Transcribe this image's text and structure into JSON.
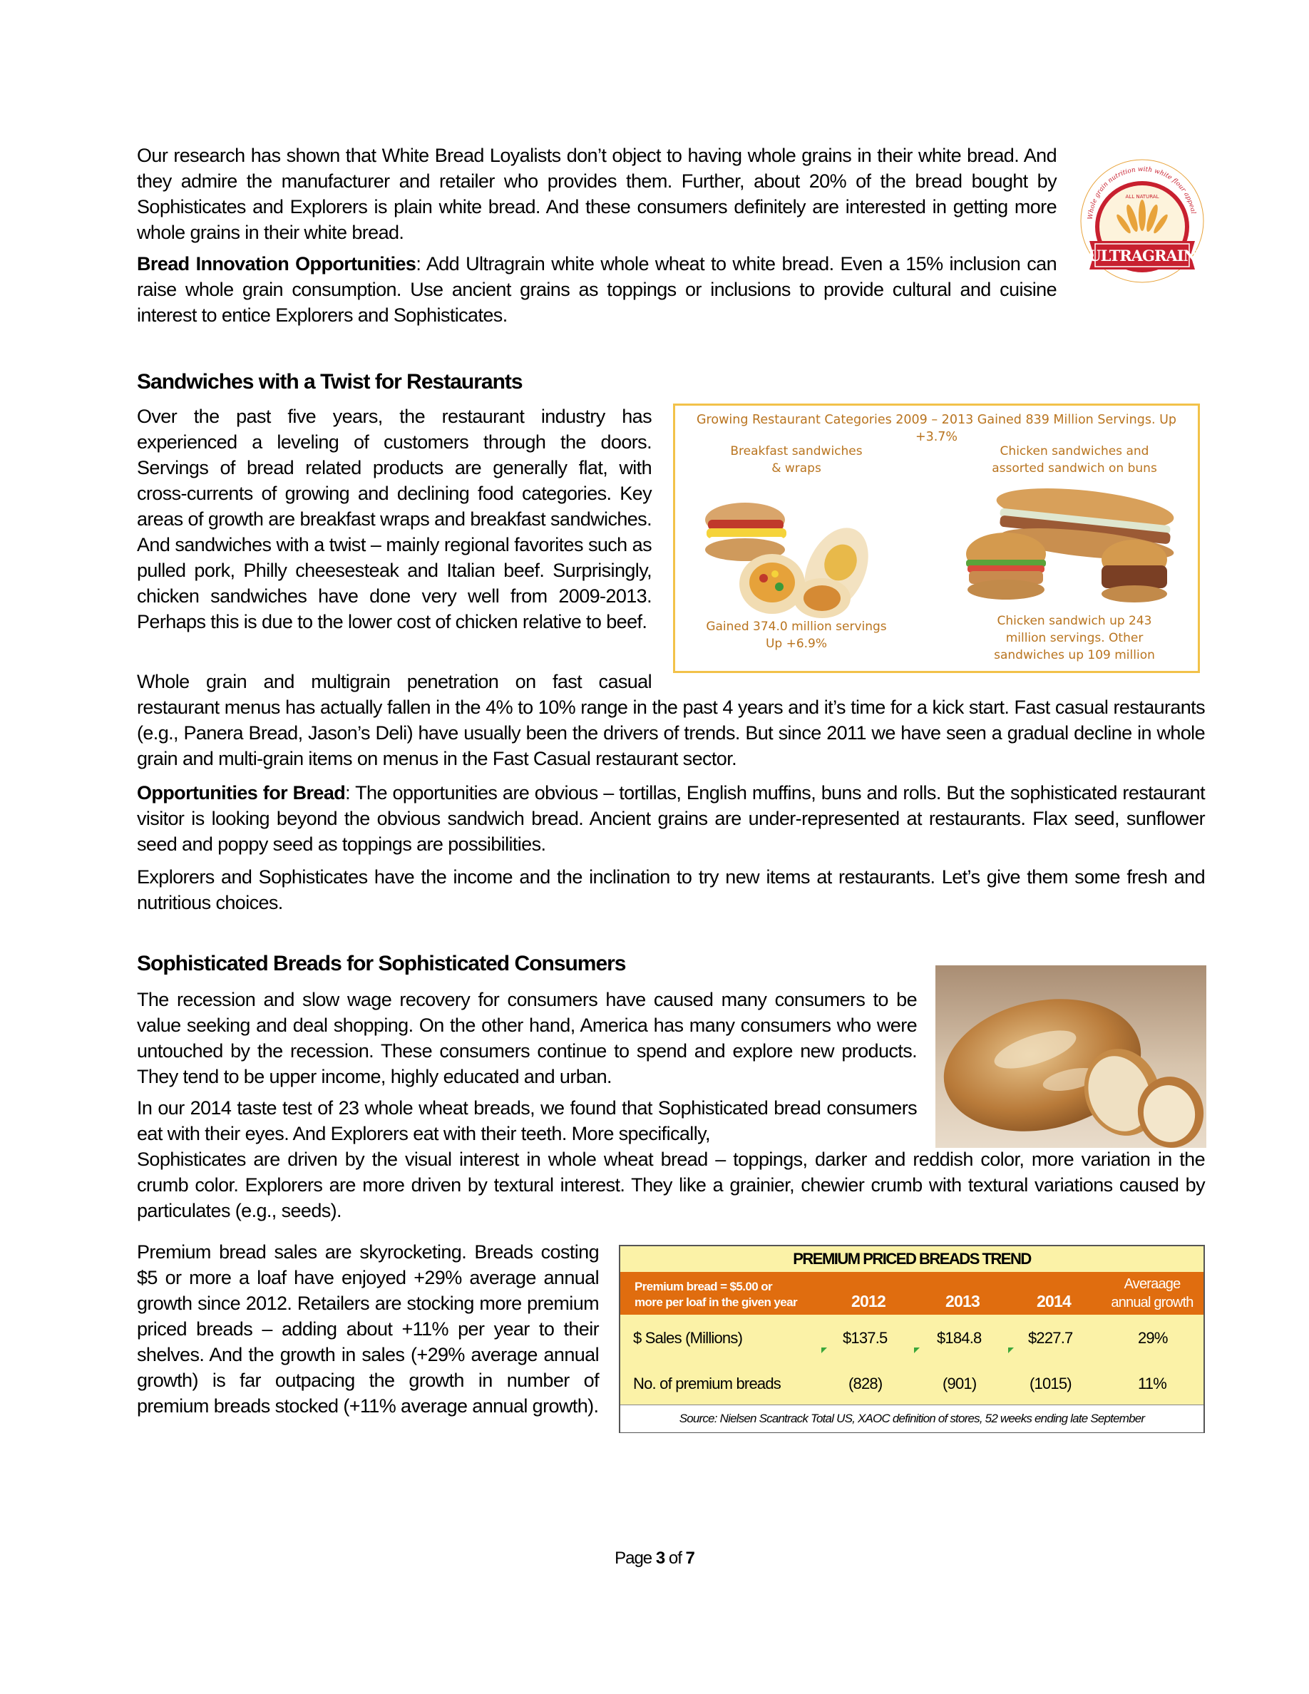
{
  "intro": {
    "para1": "Our research has shown that White Bread Loyalists don’t object to having whole grains in their white bread.  And they admire the manufacturer and retailer who provides them.   Further, about 20% of the bread bought by Sophisticates and Explorers is plain white bread.  And these consumers definitely are interested in getting more whole grains in their white bread.",
    "opp_label": "Bread Innovation Opportunities",
    "opp_text": ":   Add Ultragrain white whole wheat to white bread.  Even a 15% inclusion can raise whole grain consumption.  Use ancient grains as toppings or inclusions to provide cultural and cuisine interest to entice Explorers and Sophisticates."
  },
  "logo": {
    "arc_text": "Whole grain nutrition with white flour appeal",
    "top_text": "ALL NATURAL",
    "brand": "ULTRAGRAIN",
    "colors": {
      "red": "#c8202f",
      "gold": "#e8a33b",
      "cream": "#fdf3dc"
    }
  },
  "sandwiches": {
    "heading": "Sandwiches with a Twist for Restaurants",
    "para1": "Over the past five years, the restaurant industry has experienced a leveling of customers through the doors. Servings of bread related products are generally flat, with cross-currents of growing and declining food categories. Key areas of growth are breakfast wraps and breakfast sandwiches. And sandwiches with a twist – mainly regional favorites such as pulled pork, Philly cheesesteak and Italian beef.  Surprisingly, chicken sandwiches have done very well from 2009-2013.  Perhaps this is due to the lower cost of chicken relative to beef.",
    "para2_start": "Whole grain and multigrain penetration on fast casual",
    "para2_rest": "restaurant menus has actually fallen in the 4% to 10% range in the past 4 years and it’s time for a kick start.  Fast casual restaurants (e.g., Panera Bread, Jason’s Deli) have usually been the drivers of trends.  But since 2011 we have seen a gradual decline in whole grain and multi-grain items on menus in the Fast Casual restaurant sector.",
    "opp_label": "Opportunities for Bread",
    "opp_text": ":  The opportunities are obvious – tortillas, English muffins, buns and rolls.  But the sophisticated restaurant visitor is looking beyond the obvious sandwich bread.  Ancient grains are under-represented at restaurants.  Flax seed, sunflower seed and poppy seed as toppings are possibilities.",
    "para4": "Explorers and Sophisticates have the income and the inclination to try new items at restaurants.  Let’s give them some fresh and nutritious choices."
  },
  "infographic": {
    "title": "Growing  Restaurant Categories  2009 – 2013  Gained  839 Million Servings.  Up +3.7%",
    "left_label_1": "Breakfast sandwiches",
    "left_label_2": "& wraps",
    "right_label_1": "Chicken sandwiches and",
    "right_label_2": "assorted sandwich on buns",
    "left_stat_1": "Gained 374.0 million servings",
    "left_stat_2": "Up +6.9%",
    "right_stat_1": "Chicken sandwich up 243",
    "right_stat_2": "million servings.  Other",
    "right_stat_3": "sandwiches up 109 million"
  },
  "sophisticated": {
    "heading": "Sophisticated Breads for Sophisticated Consumers",
    "para1": "The recession and slow wage recovery for consumers have caused many consumers to be value seeking and deal shopping.  On the other hand, America has many consumers who were untouched by the recession.  These consumers continue to spend and explore new products.  They tend to be upper income, highly educated and urban.",
    "para2_start": "In our 2014 taste test of 23 whole wheat breads, we found that Sophisticated bread consumers eat with their eyes.  And Explorers eat with their teeth.   More specifically,",
    "para2_rest": "Sophisticates are driven by the visual interest in whole wheat bread – toppings, darker and reddish color, more variation in the crumb color.  Explorers are more driven by textural interest.  They like a grainier, chewier crumb with textural variations caused by particulates (e.g., seeds).",
    "para3": "Premium bread sales are skyrocketing.   Breads costing $5 or more a loaf have enjoyed +29% average annual growth since 2012.   Retailers are stocking more premium priced breads – adding about +11% per year to their shelves.  And the growth in sales (+29% average annual growth) is far outpacing the growth in number of premium breads stocked (+11% average annual growth)."
  },
  "table": {
    "title": "PREMIUM PRICED BREADS TREND",
    "header_label_1": "Premium bread = $5.00 or",
    "header_label_2": "more per loaf in the given year",
    "years": [
      "2012",
      "2013",
      "2014"
    ],
    "growth_header_1": "Averaage",
    "growth_header_2": "annual growth",
    "rows": [
      {
        "label": "$ Sales (Millions)",
        "values": [
          "$137.5",
          "$184.8",
          "$227.7"
        ],
        "growth": "29%"
      },
      {
        "label": "No. of premium breads",
        "values": [
          "(828)",
          "(901)",
          "(1015)"
        ],
        "growth": "11%"
      }
    ],
    "source": "Source:  Nielsen Scantrack  Total US, XAOC definition of stores, 52 weeks ending late September",
    "colors": {
      "header": "#e06d0f",
      "body": "#fbf2a7"
    }
  },
  "footer": {
    "prefix": "Page ",
    "current": "3",
    "middle": " of ",
    "total": "7"
  }
}
